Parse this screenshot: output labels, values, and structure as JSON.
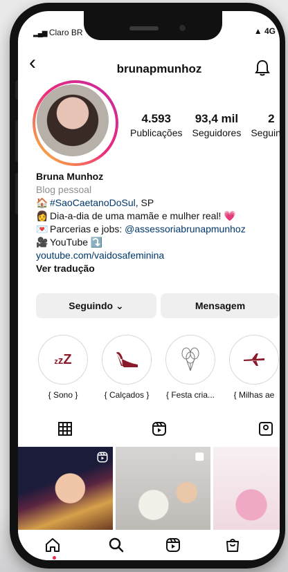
{
  "status_bar": {
    "carrier": "Claro BR",
    "right_indicator": "▲ 4G"
  },
  "header": {
    "username": "brunapmunhoz",
    "back_icon": "chevron-left-icon",
    "bell_icon": "bell-icon"
  },
  "stats": [
    {
      "num": "4.593",
      "label": "Publicações"
    },
    {
      "num": "93,4 mil",
      "label": "Seguidores"
    },
    {
      "num": "2",
      "label": "Seguindo"
    }
  ],
  "bio": {
    "name": "Bruna Munhoz",
    "category": "Blog pessoal",
    "line1_hashtag": "#SaoCaetanoDoSul",
    "line1_rest": ", SP",
    "line2": "Dia-a-dia de uma mamãe e mulher real! 💗",
    "line3_text": "Parcerias e jobs: ",
    "line3_mention": "@assessoriabrunapmunhoz",
    "line4": "YouTube ⤵️",
    "link": "youtube.com/vaidosafeminina",
    "translate": "Ver tradução"
  },
  "buttons": {
    "following": "Seguindo ⌄",
    "message": "Mensagem"
  },
  "highlights": [
    {
      "label": "{ Sono }",
      "icon": "zzz-icon"
    },
    {
      "label": "{ Calçados }",
      "icon": "high-heel-icon"
    },
    {
      "label": "{ Festa cria...",
      "icon": "balloons-icon"
    },
    {
      "label": "{ Milhas ae",
      "icon": "airplane-icon"
    }
  ],
  "tabs": [
    {
      "name": "grid-tab",
      "icon": "grid-icon"
    },
    {
      "name": "reels-tab",
      "icon": "reels-icon"
    },
    {
      "name": "tagged-tab",
      "icon": "tagged-icon"
    }
  ],
  "bottom_nav": [
    {
      "name": "home",
      "icon": "home-icon"
    },
    {
      "name": "search",
      "icon": "search-icon"
    },
    {
      "name": "reels",
      "icon": "reels-icon"
    },
    {
      "name": "shop",
      "icon": "shop-icon"
    }
  ],
  "colors": {
    "link": "#00376b",
    "ring_start": "#f9ce34",
    "ring_end": "#c32aa3",
    "button_bg": "#efefef"
  }
}
